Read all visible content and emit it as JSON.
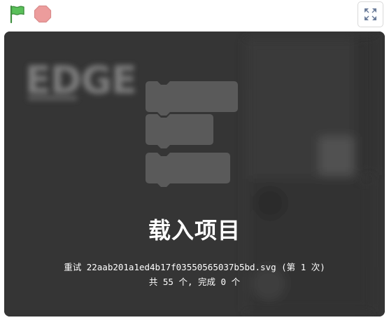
{
  "toolbar": {
    "green_flag_icon": "green-flag-icon",
    "stop_icon": "stop-sign-icon",
    "fullscreen_icon": "fullscreen-icon",
    "flag_color": "#59c059",
    "stop_color": "#ec9c9c"
  },
  "stage": {
    "background_color": "#353535",
    "background_logo_text": "EDGE",
    "loading_icon": "code-blocks-icon",
    "loading_title": "载入项目",
    "retry_line": "重试 22aab201a1ed4b17f03550565037b5bd.svg (第 1 次)",
    "progress_line": "共 55 个, 完成 0 个"
  }
}
